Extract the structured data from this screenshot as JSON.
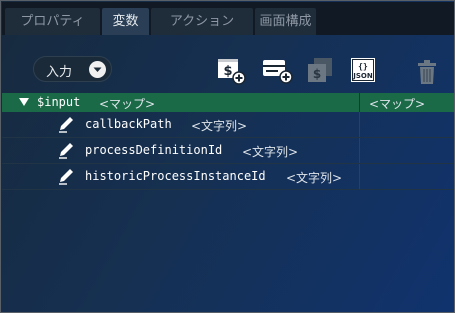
{
  "tabs": [
    {
      "label": "プロパティ",
      "active": false
    },
    {
      "label": "変数",
      "active": true
    },
    {
      "label": "アクション",
      "active": false
    },
    {
      "label": "画面構成",
      "active": false
    }
  ],
  "toolbar": {
    "direction_label": "入力",
    "json_icon_text": "JSON",
    "json_icon_braces": "{}"
  },
  "variables": {
    "root": {
      "name": "$input",
      "type": "<マップ>",
      "type_column": "<マップ>"
    },
    "children": [
      {
        "name": "callbackPath",
        "type": "<文字列>"
      },
      {
        "name": "processDefinitionId",
        "type": "<文字列>"
      },
      {
        "name": "historicProcessInstanceId",
        "type": "<文字列>"
      }
    ]
  },
  "colors": {
    "header_row": "#1a6a48",
    "active_tab": "#2a3f55",
    "background_start": "#172a3e",
    "background_end": "#10336e"
  }
}
